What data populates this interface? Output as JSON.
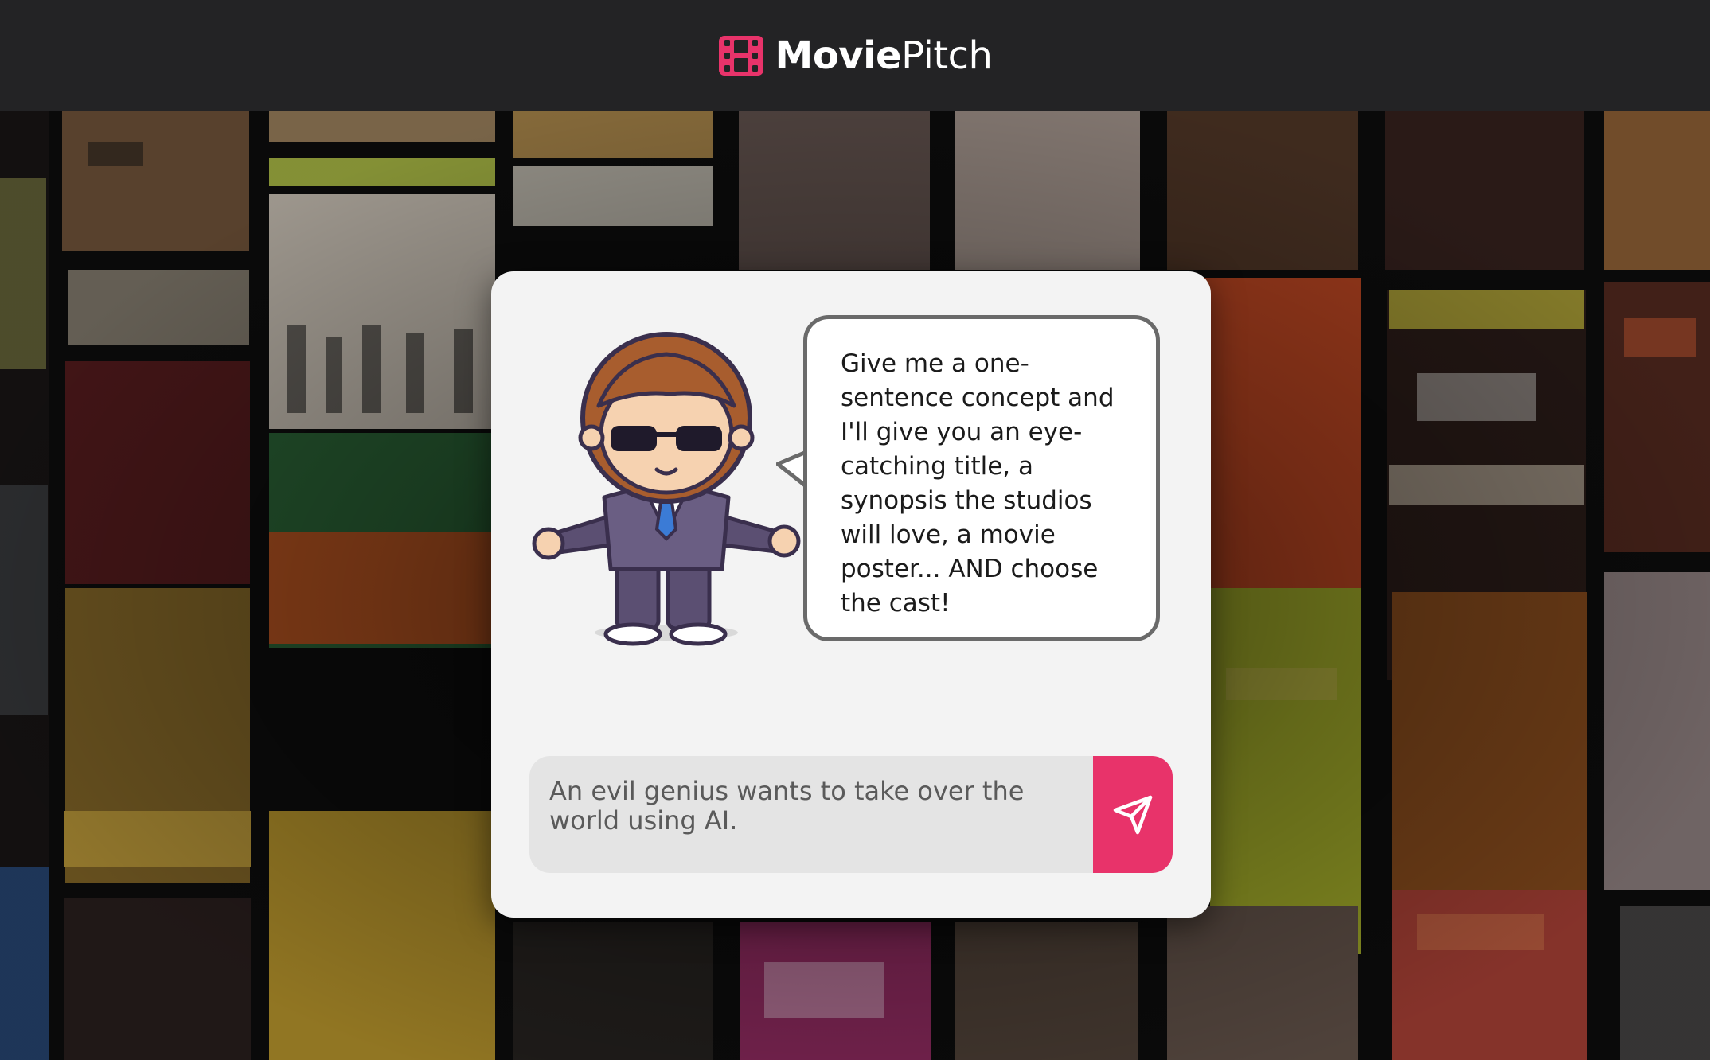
{
  "header": {
    "brand_bold": "Movie",
    "brand_light": "Pitch",
    "logo_icon": "film-reel-icon",
    "accent_color": "#e8336a",
    "background_color": "#232325"
  },
  "background": {
    "description_icon": "movie-poster-collage"
  },
  "card": {
    "mascot_icon": "mascot-producer-icon",
    "speech_text": "Give me a one-sentence concept and I'll give you an eye-catching title, a synopsis the studios will love, a movie poster... AND choose the cast!",
    "input_value": "An evil genius wants to take over the world using AI.",
    "send_icon": "send-paper-plane-icon"
  }
}
